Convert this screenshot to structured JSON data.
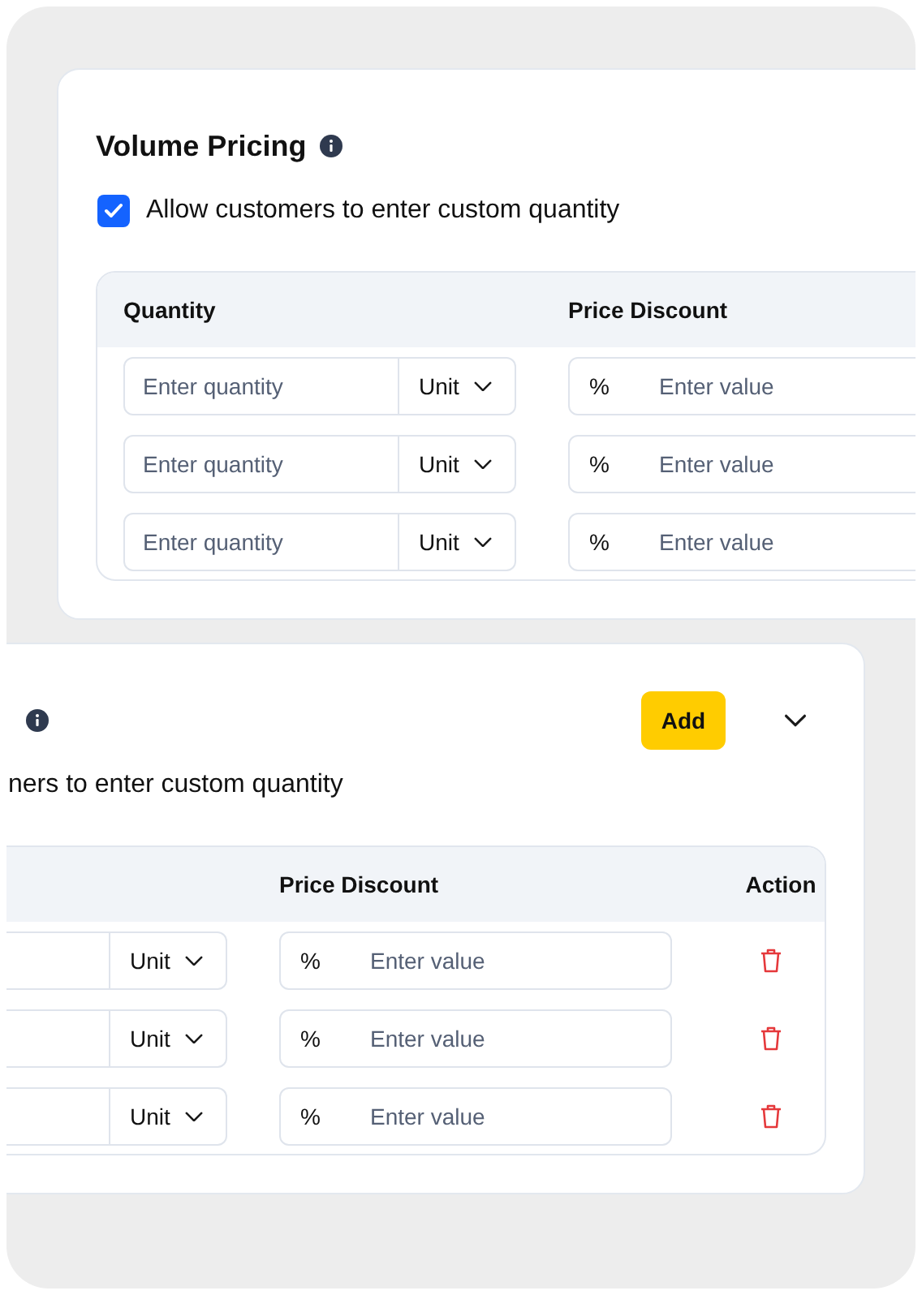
{
  "cards": [
    {
      "title": "Volume Pricing",
      "allow": {
        "checked": true,
        "label": "Allow customers to enter custom quantity"
      },
      "columns": [
        {
          "kind": "quantity",
          "label": "Quantity"
        },
        {
          "kind": "price",
          "label": "Price Discount"
        }
      ],
      "rows": [
        {
          "quantity_placeholder": "Enter quantity",
          "unit": "Unit",
          "symbol": "%",
          "value_placeholder": "Enter value"
        },
        {
          "quantity_placeholder": "Enter quantity",
          "unit": "Unit",
          "symbol": "%",
          "value_placeholder": "Enter value"
        },
        {
          "quantity_placeholder": "Enter quantity",
          "unit": "Unit",
          "symbol": "%",
          "value_placeholder": "Enter value"
        }
      ]
    },
    {
      "add_button": "Add",
      "allow": {
        "label": "ners to enter custom quantity"
      },
      "columns": [
        {
          "kind": "price",
          "label": "Price Discount"
        },
        {
          "kind": "action",
          "label": "Action"
        }
      ],
      "rows": [
        {
          "unit": "Unit",
          "symbol": "%",
          "value_placeholder": "Enter value"
        },
        {
          "unit": "Unit",
          "symbol": "%",
          "value_placeholder": "Enter value"
        },
        {
          "unit": "Unit",
          "symbol": "%",
          "value_placeholder": "Enter value"
        }
      ]
    }
  ]
}
